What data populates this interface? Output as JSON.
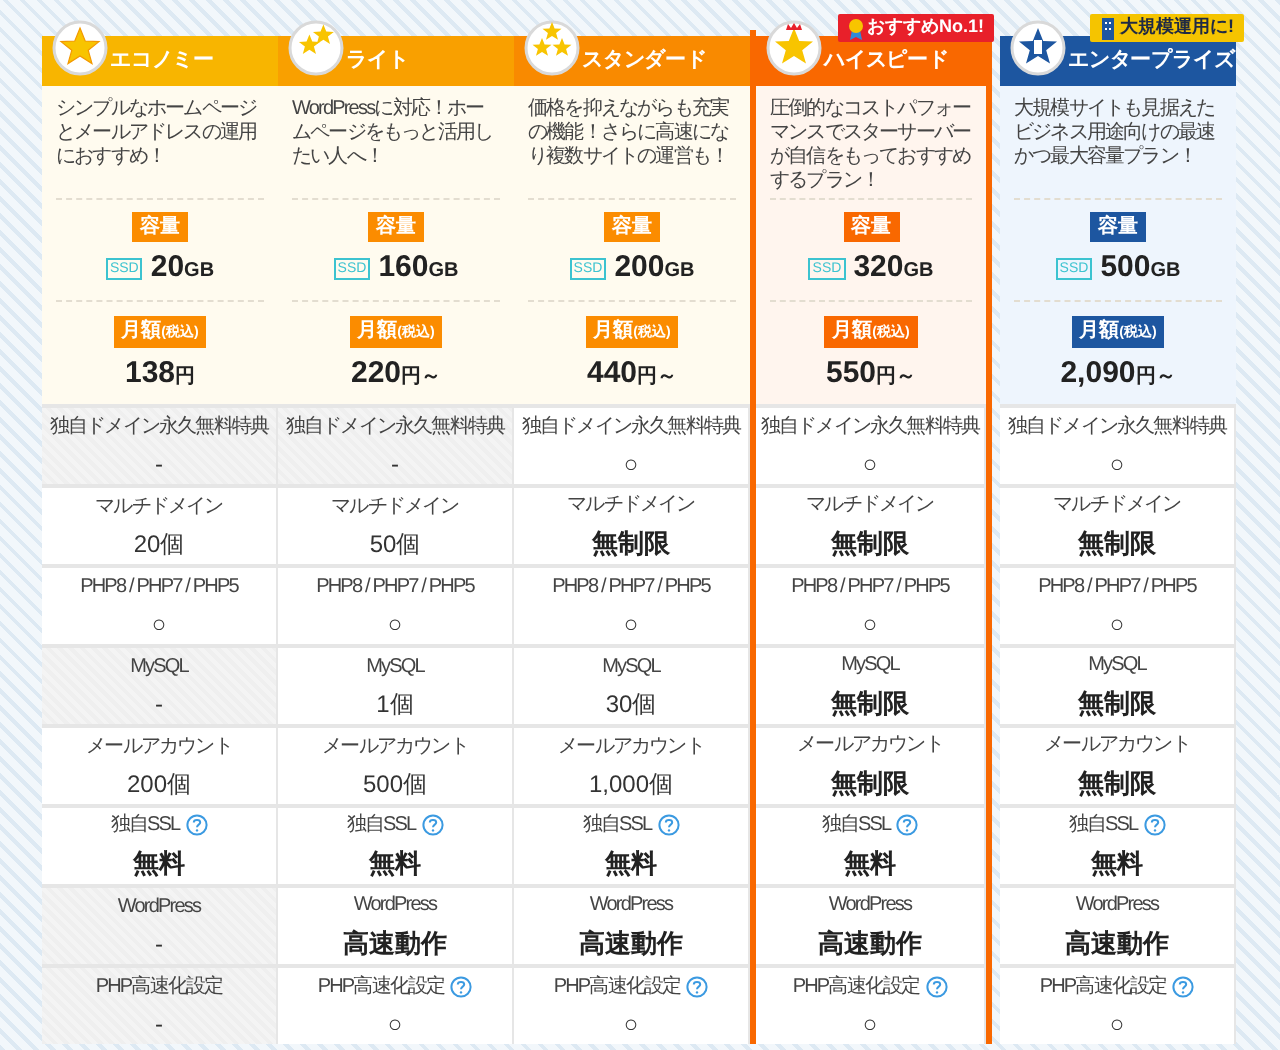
{
  "plans": [
    {
      "name": "エコノミー",
      "color": "#f8b500",
      "featured": false,
      "description": "シンプルなホームページとメールアドレスの運用におすすめ！",
      "capacity_badge": "容量",
      "ssd_label": "SSD",
      "capacity": "20",
      "capacity_unit": "GB",
      "price_badge": "月額",
      "price_badge_note": "(税込)",
      "price": "138",
      "price_unit": "円",
      "features": [
        {
          "label": "独自ドメイン永久無料特典",
          "value": "-",
          "available": false,
          "bold": false,
          "help": false
        },
        {
          "label": "マルチドメイン",
          "value": "20個",
          "available": true,
          "bold": false,
          "help": false
        },
        {
          "label": "PHP8 / PHP7 / PHP5",
          "value": "○",
          "available": true,
          "bold": false,
          "help": false
        },
        {
          "label": "MySQL",
          "value": "-",
          "available": false,
          "bold": false,
          "help": false
        },
        {
          "label": "メールアカウント",
          "value": "200個",
          "available": true,
          "bold": false,
          "help": false
        },
        {
          "label": "独自SSL",
          "value": "無料",
          "available": true,
          "bold": true,
          "help": true
        },
        {
          "label": "WordPress",
          "value": "-",
          "available": false,
          "bold": false,
          "help": false
        },
        {
          "label": "PHP高速化設定",
          "value": "-",
          "available": false,
          "bold": false,
          "help": false
        }
      ]
    },
    {
      "name": "ライト",
      "color": "#f9a000",
      "featured": false,
      "description": "WordPressに対応！ホームページをもっと活用したい人へ！",
      "capacity_badge": "容量",
      "ssd_label": "SSD",
      "capacity": "160",
      "capacity_unit": "GB",
      "price_badge": "月額",
      "price_badge_note": "(税込)",
      "price": "220",
      "price_unit": "円～",
      "features": [
        {
          "label": "独自ドメイン永久無料特典",
          "value": "-",
          "available": false,
          "bold": false,
          "help": false
        },
        {
          "label": "マルチドメイン",
          "value": "50個",
          "available": true,
          "bold": false,
          "help": false
        },
        {
          "label": "PHP8 / PHP7 / PHP5",
          "value": "○",
          "available": true,
          "bold": false,
          "help": false
        },
        {
          "label": "MySQL",
          "value": "1個",
          "available": true,
          "bold": false,
          "help": false
        },
        {
          "label": "メールアカウント",
          "value": "500個",
          "available": true,
          "bold": false,
          "help": false
        },
        {
          "label": "独自SSL",
          "value": "無料",
          "available": true,
          "bold": true,
          "help": true
        },
        {
          "label": "WordPress",
          "value": "高速動作",
          "available": true,
          "bold": true,
          "help": false
        },
        {
          "label": "PHP高速化設定",
          "value": "○",
          "available": true,
          "bold": false,
          "help": true
        }
      ]
    },
    {
      "name": "スタンダード",
      "color": "#f98a00",
      "featured": false,
      "description": "価格を抑えながらも充実の機能！さらに高速になり複数サイトの運営も！",
      "capacity_badge": "容量",
      "ssd_label": "SSD",
      "capacity": "200",
      "capacity_unit": "GB",
      "price_badge": "月額",
      "price_badge_note": "(税込)",
      "price": "440",
      "price_unit": "円～",
      "features": [
        {
          "label": "独自ドメイン永久無料特典",
          "value": "○",
          "available": true,
          "bold": false,
          "help": false
        },
        {
          "label": "マルチドメイン",
          "value": "無制限",
          "available": true,
          "bold": true,
          "help": false
        },
        {
          "label": "PHP8 / PHP7 / PHP5",
          "value": "○",
          "available": true,
          "bold": false,
          "help": false
        },
        {
          "label": "MySQL",
          "value": "30個",
          "available": true,
          "bold": false,
          "help": false
        },
        {
          "label": "メールアカウント",
          "value": "1,000個",
          "available": true,
          "bold": false,
          "help": false
        },
        {
          "label": "独自SSL",
          "value": "無料",
          "available": true,
          "bold": true,
          "help": true
        },
        {
          "label": "WordPress",
          "value": "高速動作",
          "available": true,
          "bold": true,
          "help": false
        },
        {
          "label": "PHP高速化設定",
          "value": "○",
          "available": true,
          "bold": false,
          "help": true
        }
      ]
    },
    {
      "name": "ハイスピード",
      "color": "#f96800",
      "featured": true,
      "ribbon": {
        "text": "おすすめNo.1!",
        "color": "#e8202a"
      },
      "description": "圧倒的なコストパフォーマンスでスターサーバーが自信をもっておすすめするプラン！",
      "capacity_badge": "容量",
      "ssd_label": "SSD",
      "capacity": "320",
      "capacity_unit": "GB",
      "price_badge": "月額",
      "price_badge_note": "(税込)",
      "price": "550",
      "price_unit": "円～",
      "features": [
        {
          "label": "独自ドメイン永久無料特典",
          "value": "○",
          "available": true,
          "bold": false,
          "help": false
        },
        {
          "label": "マルチドメイン",
          "value": "無制限",
          "available": true,
          "bold": true,
          "help": false
        },
        {
          "label": "PHP8 / PHP7 / PHP5",
          "value": "○",
          "available": true,
          "bold": false,
          "help": false
        },
        {
          "label": "MySQL",
          "value": "無制限",
          "available": true,
          "bold": true,
          "help": false
        },
        {
          "label": "メールアカウント",
          "value": "無制限",
          "available": true,
          "bold": true,
          "help": false
        },
        {
          "label": "独自SSL",
          "value": "無料",
          "available": true,
          "bold": true,
          "help": true
        },
        {
          "label": "WordPress",
          "value": "高速動作",
          "available": true,
          "bold": true,
          "help": false
        },
        {
          "label": "PHP高速化設定",
          "value": "○",
          "available": true,
          "bold": false,
          "help": true
        }
      ]
    },
    {
      "name": "エンタープライズ",
      "color": "#1d56a0",
      "featured": false,
      "ribbon": {
        "text": "大規模運用に!",
        "color": "#f5c400"
      },
      "description": "大規模サイトも見据えたビジネス用途向けの最速かつ最大容量プラン！",
      "capacity_badge": "容量",
      "ssd_label": "SSD",
      "capacity": "500",
      "capacity_unit": "GB",
      "price_badge": "月額",
      "price_badge_note": "(税込)",
      "price": "2,090",
      "price_unit": "円～",
      "features": [
        {
          "label": "独自ドメイン永久無料特典",
          "value": "○",
          "available": true,
          "bold": false,
          "help": false
        },
        {
          "label": "マルチドメイン",
          "value": "無制限",
          "available": true,
          "bold": true,
          "help": false
        },
        {
          "label": "PHP8 / PHP7 / PHP5",
          "value": "○",
          "available": true,
          "bold": false,
          "help": false
        },
        {
          "label": "MySQL",
          "value": "無制限",
          "available": true,
          "bold": true,
          "help": false
        },
        {
          "label": "メールアカウント",
          "value": "無制限",
          "available": true,
          "bold": true,
          "help": false
        },
        {
          "label": "独自SSL",
          "value": "無料",
          "available": true,
          "bold": true,
          "help": true
        },
        {
          "label": "WordPress",
          "value": "高速動作",
          "available": true,
          "bold": true,
          "help": false
        },
        {
          "label": "PHP高速化設定",
          "value": "○",
          "available": true,
          "bold": false,
          "help": true
        }
      ]
    }
  ]
}
